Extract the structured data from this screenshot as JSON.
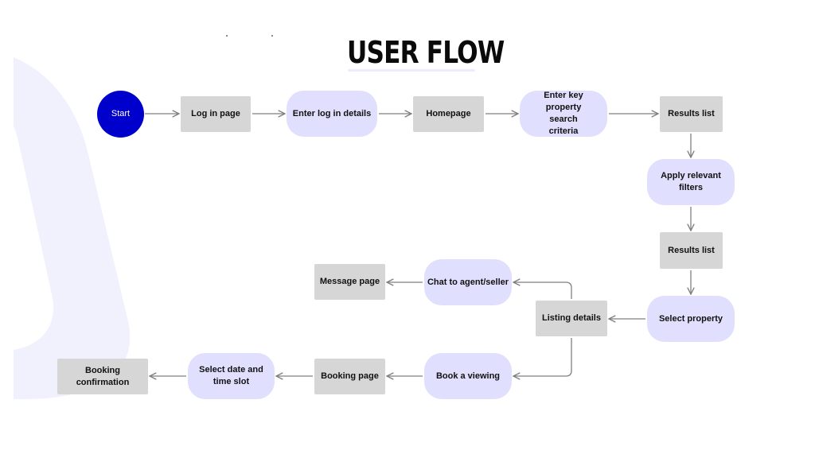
{
  "title": "USER FLOW",
  "colors": {
    "start_fill": "#0000cc",
    "page_fill": "#d6d6d6",
    "action_fill": "#e0dffe",
    "connector": "#7f7f7f",
    "background_shape": "#f1f0fd"
  },
  "legend_types": {
    "start": "circle",
    "page": "rectangle",
    "action": "pill"
  },
  "nodes": [
    {
      "id": "start",
      "label": "Start",
      "type": "start"
    },
    {
      "id": "login-page",
      "label": "Log in page",
      "type": "page"
    },
    {
      "id": "enter-login-details",
      "label": "Enter log in details",
      "type": "action"
    },
    {
      "id": "homepage",
      "label": "Homepage",
      "type": "page"
    },
    {
      "id": "enter-search-criteria",
      "label": "Enter key property search criteria",
      "type": "action"
    },
    {
      "id": "results-list-1",
      "label": "Results list",
      "type": "page"
    },
    {
      "id": "apply-filters",
      "label": "Apply relevant filters",
      "type": "action"
    },
    {
      "id": "results-list-2",
      "label": "Results list",
      "type": "page"
    },
    {
      "id": "select-property",
      "label": "Select property",
      "type": "action"
    },
    {
      "id": "listing-details",
      "label": "Listing details",
      "type": "page"
    },
    {
      "id": "chat-agent",
      "label": "Chat to agent/seller",
      "type": "action"
    },
    {
      "id": "message-page",
      "label": "Message page",
      "type": "page"
    },
    {
      "id": "book-viewing",
      "label": "Book a viewing",
      "type": "action"
    },
    {
      "id": "booking-page",
      "label": "Booking page",
      "type": "page"
    },
    {
      "id": "select-date-time",
      "label": "Select date and time slot",
      "type": "action"
    },
    {
      "id": "booking-confirmation",
      "label": "Booking confirmation",
      "type": "page"
    }
  ],
  "edges": [
    {
      "from": "start",
      "to": "login-page"
    },
    {
      "from": "login-page",
      "to": "enter-login-details"
    },
    {
      "from": "enter-login-details",
      "to": "homepage"
    },
    {
      "from": "homepage",
      "to": "enter-search-criteria"
    },
    {
      "from": "enter-search-criteria",
      "to": "results-list-1"
    },
    {
      "from": "results-list-1",
      "to": "apply-filters"
    },
    {
      "from": "apply-filters",
      "to": "results-list-2"
    },
    {
      "from": "results-list-2",
      "to": "select-property"
    },
    {
      "from": "select-property",
      "to": "listing-details"
    },
    {
      "from": "listing-details",
      "to": "chat-agent"
    },
    {
      "from": "chat-agent",
      "to": "message-page"
    },
    {
      "from": "listing-details",
      "to": "book-viewing"
    },
    {
      "from": "book-viewing",
      "to": "booking-page"
    },
    {
      "from": "booking-page",
      "to": "select-date-time"
    },
    {
      "from": "select-date-time",
      "to": "booking-confirmation"
    }
  ]
}
